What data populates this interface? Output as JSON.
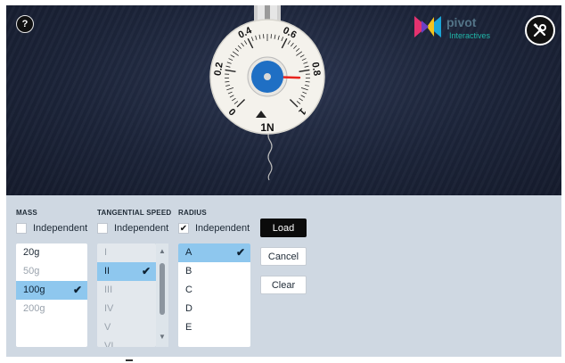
{
  "stage": {
    "help_label": "?",
    "logo": {
      "name": "pivot",
      "subtitle": "Interactives",
      "icon": "pivot-logo-icon"
    },
    "tools_icon": "tools-icon"
  },
  "spring_scale": {
    "unit_label": "1N",
    "ticks": [
      "0",
      "0.2",
      "0.4",
      "0.6",
      "0.8",
      "1"
    ],
    "reading_n": 0.84,
    "needle_color": "#e8231d",
    "hub_color": "#1f6fc4"
  },
  "controls": {
    "mass": {
      "title": "MASS",
      "independent_label": "Independent",
      "independent_checked": false,
      "options": [
        "20g",
        "50g",
        "100g",
        "200g"
      ],
      "selected": "100g"
    },
    "tangential_speed": {
      "title": "TANGENTIAL SPEED",
      "independent_label": "Independent",
      "independent_checked": false,
      "options": [
        "I",
        "II",
        "III",
        "IV",
        "V",
        "VI"
      ],
      "selected": "II"
    },
    "radius": {
      "title": "RADIUS",
      "independent_label": "Independent",
      "independent_checked": true,
      "options": [
        "A",
        "B",
        "C",
        "D",
        "E"
      ],
      "selected": "A"
    },
    "buttons": {
      "load": "Load",
      "cancel": "Cancel",
      "clear": "Clear"
    }
  },
  "colors": {
    "selection": "#8ec7ee",
    "panel": "#cfd8e2",
    "primary_button": "#0b0b0b"
  }
}
